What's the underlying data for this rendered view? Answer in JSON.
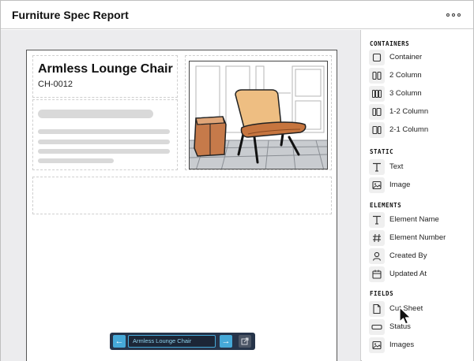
{
  "app": {
    "title": "Furniture Spec Report",
    "menu_icon": "more-horizontal-icon"
  },
  "document": {
    "title": "Armless Lounge Chair",
    "number": "CH-0012",
    "image_icon": "lounge-chair-illustration"
  },
  "pager": {
    "prev_icon": "arrow-left-icon",
    "current": "Armless Lounge Chair",
    "next_icon": "arrow-right-icon",
    "open_icon": "external-link-icon"
  },
  "sidebar": {
    "sections": [
      {
        "title": "CONTAINERS",
        "items": [
          {
            "label": "Container",
            "icon": "square-icon"
          },
          {
            "label": "2 Column",
            "icon": "two-column-icon"
          },
          {
            "label": "3 Column",
            "icon": "three-column-icon"
          },
          {
            "label": "1-2 Column",
            "icon": "one-two-column-icon"
          },
          {
            "label": "2-1 Column",
            "icon": "two-one-column-icon"
          }
        ]
      },
      {
        "title": "STATIC",
        "items": [
          {
            "label": "Text",
            "icon": "text-icon"
          },
          {
            "label": "Image",
            "icon": "image-icon"
          }
        ]
      },
      {
        "title": "ELEMENTS",
        "items": [
          {
            "label": "Element Name",
            "icon": "text-icon"
          },
          {
            "label": "Element Number",
            "icon": "hash-icon"
          },
          {
            "label": "Created By",
            "icon": "user-icon"
          },
          {
            "label": "Updated At",
            "icon": "calendar-icon"
          }
        ]
      },
      {
        "title": "FIELDS",
        "items": [
          {
            "label": "Cut Sheet",
            "icon": "file-icon"
          },
          {
            "label": "Status",
            "icon": "input-field-icon"
          },
          {
            "label": "Images",
            "icon": "image-icon"
          }
        ]
      }
    ]
  }
}
